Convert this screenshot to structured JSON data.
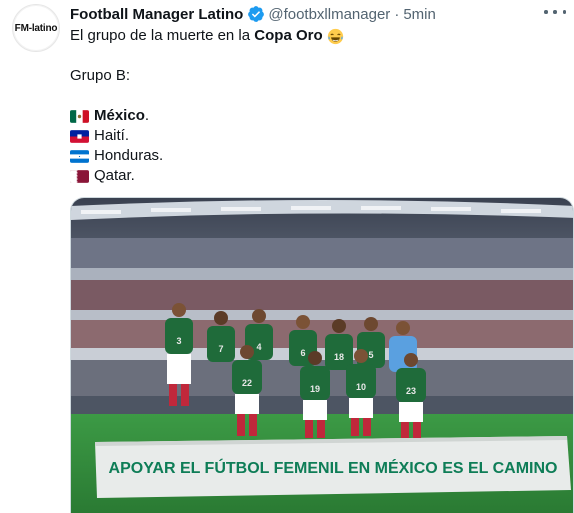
{
  "account": {
    "avatar_text": "FM-latino",
    "display_name": "Football Manager Latino",
    "handle": "@footbxllmanager",
    "separator": "·",
    "time": "5min"
  },
  "tweet": {
    "intro_text": "El grupo de la muerte en la ",
    "intro_bold": "Copa Oro",
    "intro_emoji": "face-with-tears-of-joy-icon",
    "group_label": "Grupo B:",
    "teams": [
      {
        "name": "México",
        "suffix": ".",
        "bold": true,
        "flag": "mexico-flag-icon"
      },
      {
        "name": "Haití.",
        "flag": "haiti-flag-icon"
      },
      {
        "name": "Honduras.",
        "flag": "honduras-flag-icon"
      },
      {
        "name": "Qatar.",
        "flag": "qatar-flag-icon"
      }
    ]
  },
  "media": {
    "banner_text": "APOYAR EL FÚTBOL FEMENIL EN MÉXICO ES EL CAMINO",
    "players_front": [
      "22",
      "19",
      "10",
      "23"
    ],
    "players_back": [
      "3",
      "7",
      "4",
      "6",
      "18",
      "5"
    ]
  },
  "colors": {
    "verified": "#1d9bf0",
    "jersey": "#1f6b3a",
    "pitch": "#2e8b3e",
    "banner": "#e8ebea",
    "banner_text": "#0e7d57"
  }
}
